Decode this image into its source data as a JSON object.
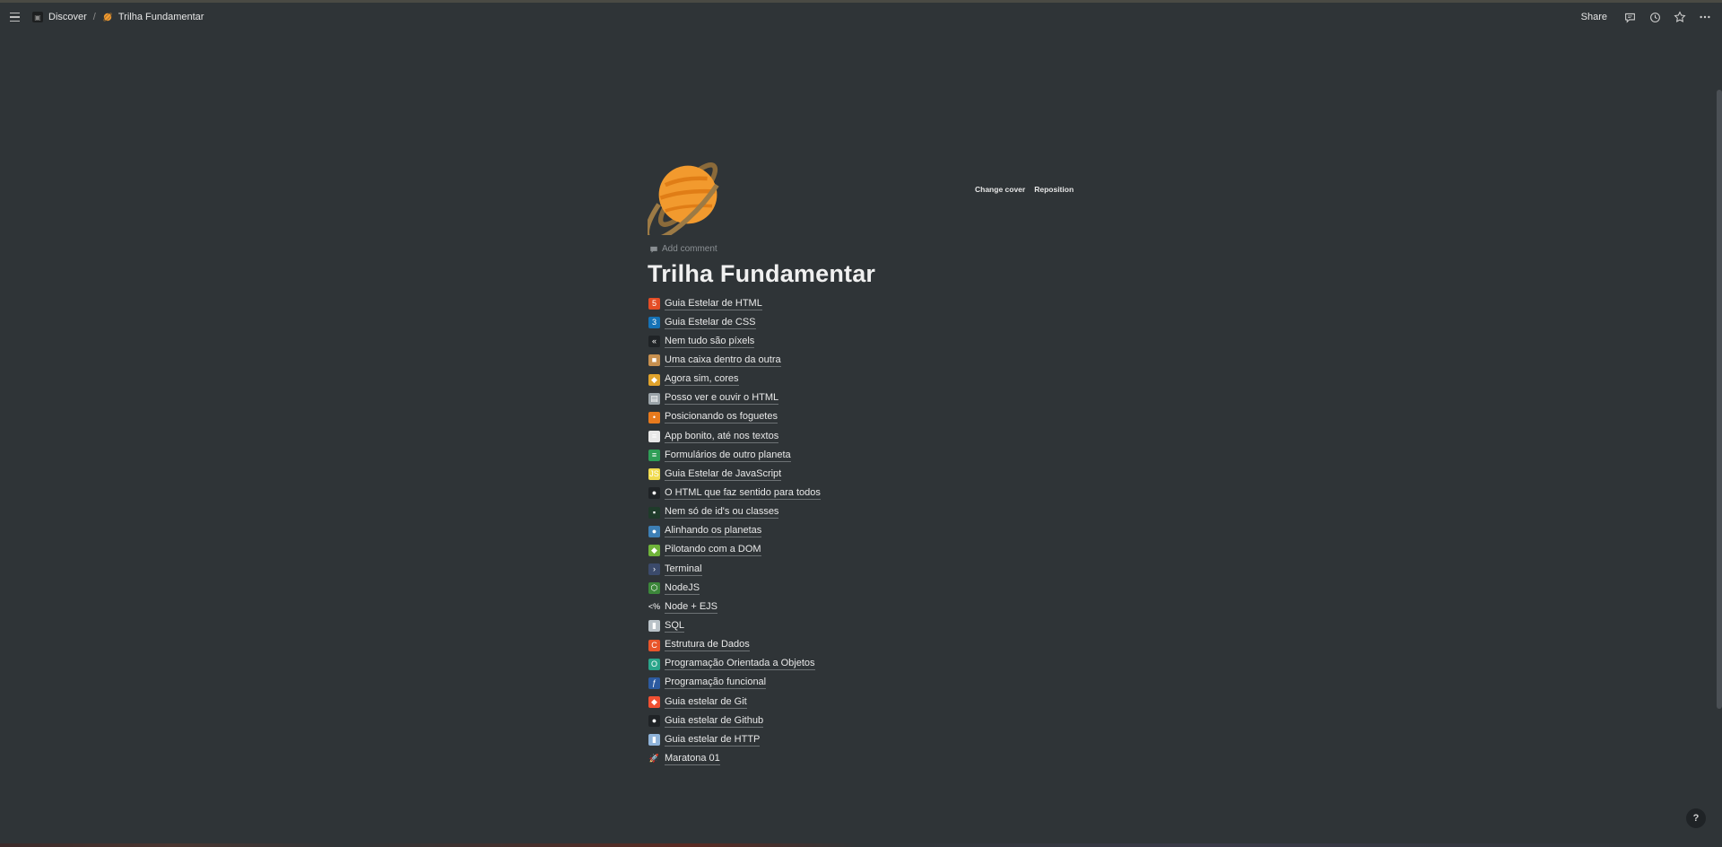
{
  "breadcrumb": {
    "items": [
      {
        "label": "Discover",
        "icon": "workspace-icon"
      },
      {
        "label": "Trilha Fundamentar",
        "icon": "ringed-planet-icon"
      }
    ],
    "separator": "/"
  },
  "topbar": {
    "share_label": "Share",
    "icons": [
      "comments-icon",
      "updates-clock-icon",
      "favorite-star-icon",
      "more-dots-icon"
    ]
  },
  "cover": {
    "change_label": "Change cover",
    "reposition_label": "Reposition"
  },
  "page": {
    "add_comment_label": "Add comment",
    "title": "Trilha Fundamentar",
    "icon": "ringed-planet-icon"
  },
  "links": [
    {
      "label": "Guia Estelar de HTML",
      "icon": "html5-icon",
      "color": "#e44d26",
      "glyph": "5"
    },
    {
      "label": "Guia Estelar de CSS",
      "icon": "css3-icon",
      "color": "#1572b6",
      "glyph": "3"
    },
    {
      "label": "Nem tudo são píxels",
      "icon": "chevrons-left-icon",
      "color": "#1f2326",
      "glyph": "«"
    },
    {
      "label": "Uma caixa dentro da outra",
      "icon": "box-icon",
      "color": "#c7904f",
      "glyph": "■"
    },
    {
      "label": "Agora sim, cores",
      "icon": "color-palette-icon",
      "color": "#e0a32c",
      "glyph": "◆"
    },
    {
      "label": "Posso ver e ouvir o HTML",
      "icon": "media-icon",
      "color": "#9aa3a8",
      "glyph": "▤"
    },
    {
      "label": "Posicionando os foguetes",
      "icon": "rocket-dot-icon",
      "color": "#e87a1d",
      "glyph": "•"
    },
    {
      "label": "App bonito, até nos textos",
      "icon": "document-icon",
      "color": "#e8e8e8",
      "glyph": "≡"
    },
    {
      "label": "Formulários de outro planeta",
      "icon": "form-icon",
      "color": "#2f9e57",
      "glyph": "≡"
    },
    {
      "label": "Guia Estelar de JavaScript",
      "icon": "javascript-icon",
      "color": "#f0db4f",
      "glyph": "JS"
    },
    {
      "label": "O HTML que faz sentido para todos",
      "icon": "accessibility-icon",
      "color": "#1f2326",
      "glyph": "●"
    },
    {
      "label": "Nem só de id's ou classes",
      "icon": "terminal-green-icon",
      "color": "#1f3b2a",
      "glyph": "▪"
    },
    {
      "label": "Alinhando os planetas",
      "icon": "planet-icon",
      "color": "#3d7fb5",
      "glyph": "●"
    },
    {
      "label": "Pilotando com a DOM",
      "icon": "cube-icon",
      "color": "#6fb33a",
      "glyph": "◆"
    },
    {
      "label": "Terminal",
      "icon": "terminal-icon",
      "color": "#3b4a6b",
      "glyph": "›"
    },
    {
      "label": "NodeJS",
      "icon": "nodejs-icon",
      "color": "#3c873a",
      "glyph": "⬡"
    },
    {
      "label": "Node + EJS",
      "icon": "ejs-icon",
      "color": "#2f3437",
      "glyph": "<%"
    },
    {
      "label": "SQL",
      "icon": "database-icon",
      "color": "#b9c2c8",
      "glyph": "▮"
    },
    {
      "label": "Estrutura de Dados",
      "icon": "data-structure-icon",
      "color": "#e8552b",
      "glyph": "C"
    },
    {
      "label": "Programação Orientada a Objetos",
      "icon": "oop-icon",
      "color": "#2aa58a",
      "glyph": "O"
    },
    {
      "label": "Programação funcional",
      "icon": "functional-icon",
      "color": "#2c5aa0",
      "glyph": "ƒ"
    },
    {
      "label": "Guia estelar de Git",
      "icon": "git-icon",
      "color": "#f05032",
      "glyph": "◆"
    },
    {
      "label": "Guia estelar de Github",
      "icon": "github-icon",
      "color": "#1f2326",
      "glyph": "●"
    },
    {
      "label": "Guia estelar de HTTP",
      "icon": "http-icon",
      "color": "#8fb3d9",
      "glyph": "▮"
    },
    {
      "label": "Maratona 01",
      "icon": "rocket-icon",
      "color": "#2f3437",
      "glyph": "🚀"
    }
  ],
  "help": {
    "label": "?"
  }
}
